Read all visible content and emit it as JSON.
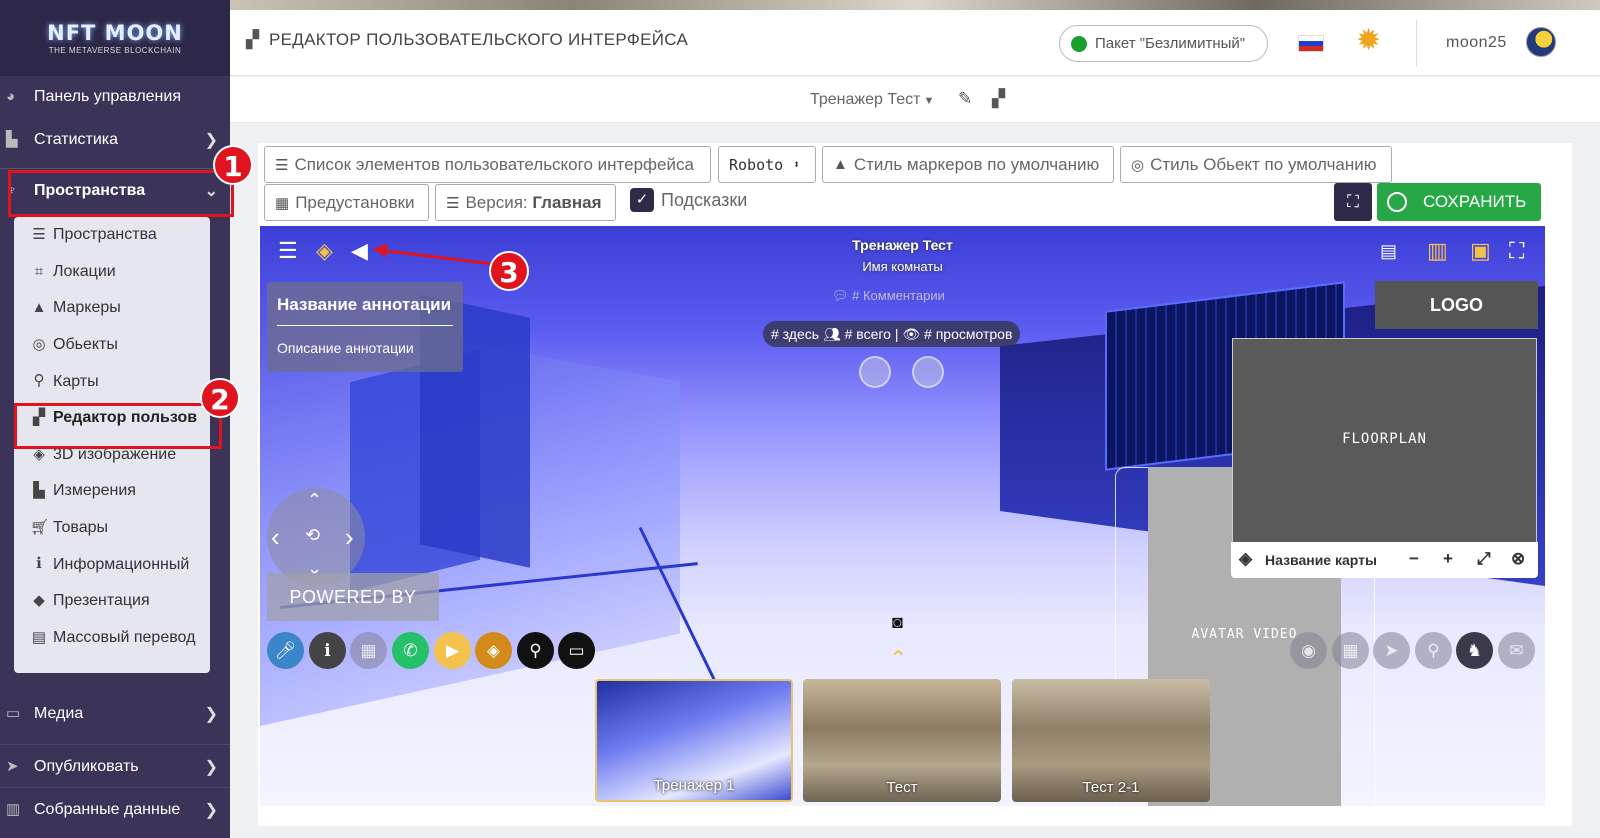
{
  "sidebar": {
    "logo_main": "NFT MOON",
    "logo_sub": "THE METAVERSE BLOCKCHAIN",
    "items": [
      {
        "label": "Панель управления",
        "icon": "dashboard-icon"
      },
      {
        "label": "Статистика",
        "icon": "chart-icon"
      },
      {
        "label": "Пространства",
        "icon": "spaces-icon"
      },
      {
        "label": "Медиа",
        "icon": "media-icon"
      },
      {
        "label": "Опубликовать",
        "icon": "send-icon"
      },
      {
        "label": "Собранные данные",
        "icon": "data-icon"
      }
    ],
    "sub_items": [
      {
        "label": "Пространства",
        "icon": "list-icon"
      },
      {
        "label": "Локации",
        "icon": "location-icon"
      },
      {
        "label": "Маркеры",
        "icon": "marker-icon"
      },
      {
        "label": "Обьекты",
        "icon": "target-icon"
      },
      {
        "label": "Карты",
        "icon": "map-icon"
      },
      {
        "label": "Редактор пользов",
        "icon": "ui-editor-icon"
      },
      {
        "label": "3D изображение",
        "icon": "cube-icon"
      },
      {
        "label": "Измерения",
        "icon": "ruler-icon"
      },
      {
        "label": "Товары",
        "icon": "cart-icon"
      },
      {
        "label": "Информационный",
        "icon": "info-icon"
      },
      {
        "label": "Презентация",
        "icon": "presentation-icon"
      },
      {
        "label": "Массовый перевод",
        "icon": "translate-icon"
      }
    ]
  },
  "annotations": {
    "badge1": "1",
    "badge2": "2",
    "badge3": "3",
    "color": "#e0141e"
  },
  "header": {
    "title": "РЕДАКТОР ПОЛЬЗОВАТЕЛЬСКОГО ИНТЕРФЕЙСА",
    "plan": "Пакет \"Безлимитный\"",
    "username": "moon25"
  },
  "subbar": {
    "tour_name": "Тренажер Тест"
  },
  "toolbar": {
    "elements_list": "Список элементов пользовательского интерфейса",
    "font": "Roboto",
    "marker_style": "Стиль маркеров по умолчанию",
    "object_style": "Стиль Обьект по умолчанию",
    "presets": "Предустановки",
    "version_label": "Версия:",
    "version_value": "Главная",
    "hints": "Подсказки",
    "save": "СОХРАНИТЬ"
  },
  "viewer": {
    "tour_title": "Тренажер Тест",
    "room_name": "Имя комнаты",
    "comments": "# Комментарии",
    "stats_here": "# здесь",
    "stats_total": "# всего",
    "stats_sep": "|",
    "stats_views": "# просмотров",
    "annotation_title": "Название аннотации",
    "annotation_desc": "Описание аннотации",
    "logo": "LOGO",
    "floorplan": "FLOORPLAN",
    "map_name": "Название карты",
    "avatar_video": "AVATAR VIDEO",
    "powered_by": "POWERED BY",
    "thumbnails": [
      "Тренажер 1",
      "Тест",
      "Тест 2-1"
    ]
  }
}
